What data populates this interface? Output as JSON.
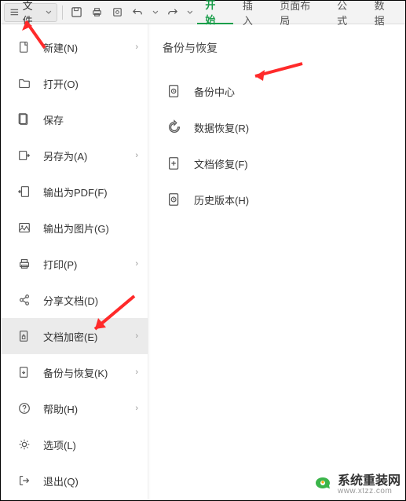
{
  "toolbar": {
    "file_label": "文件",
    "tabs": {
      "start": "开始",
      "insert": "插入",
      "layout": "页面布局",
      "formula": "公式",
      "data": "数据"
    }
  },
  "sidebar": {
    "items": [
      {
        "label": "新建(N)"
      },
      {
        "label": "打开(O)"
      },
      {
        "label": "保存"
      },
      {
        "label": "另存为(A)"
      },
      {
        "label": "输出为PDF(F)"
      },
      {
        "label": "输出为图片(G)"
      },
      {
        "label": "打印(P)"
      },
      {
        "label": "分享文档(D)"
      },
      {
        "label": "文档加密(E)"
      },
      {
        "label": "备份与恢复(K)"
      },
      {
        "label": "帮助(H)"
      },
      {
        "label": "选项(L)"
      },
      {
        "label": "退出(Q)"
      }
    ]
  },
  "panel": {
    "title": "备份与恢复",
    "items": [
      {
        "label": "备份中心"
      },
      {
        "label": "数据恢复(R)"
      },
      {
        "label": "文档修复(F)"
      },
      {
        "label": "历史版本(H)"
      }
    ]
  },
  "watermark": {
    "title": "系统重装网",
    "url": "www.xtzz.com"
  }
}
